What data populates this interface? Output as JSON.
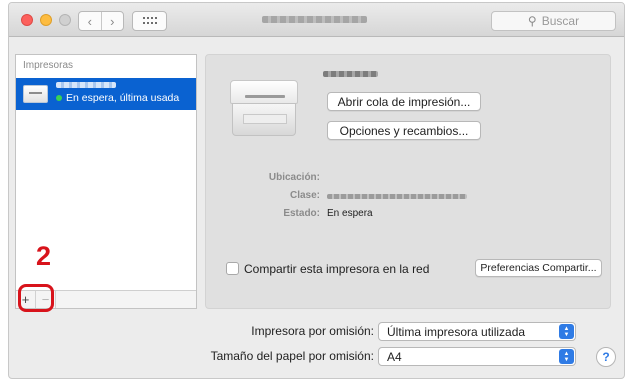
{
  "search": {
    "placeholder": "Buscar",
    "icon": "magnifier-icon"
  },
  "sidebar": {
    "header": "Impresoras",
    "printers": [
      {
        "status": "En espera, última usada",
        "selected": true
      }
    ],
    "add_label": "+",
    "remove_label": "−"
  },
  "annotation": {
    "step": "2",
    "color": "#d8131b"
  },
  "details": {
    "open_queue_label": "Abrir cola de impresión...",
    "options_label": "Opciones y recambios...",
    "location_label": "Ubicación:",
    "kind_label": "Clase:",
    "status_label": "Estado:",
    "status_value": "En espera",
    "share_label": "Compartir esta impresora en la red",
    "share_checked": false,
    "share_prefs_label": "Preferencias Compartir..."
  },
  "defaults": {
    "default_printer_label": "Impresora por omisión:",
    "default_printer_value": "Última impresora utilizada",
    "default_paper_label": "Tamaño del papel por omisión:",
    "default_paper_value": "A4"
  },
  "help_label": "?",
  "colors": {
    "selection": "#0a62d1",
    "accent": "#2f7be5"
  }
}
